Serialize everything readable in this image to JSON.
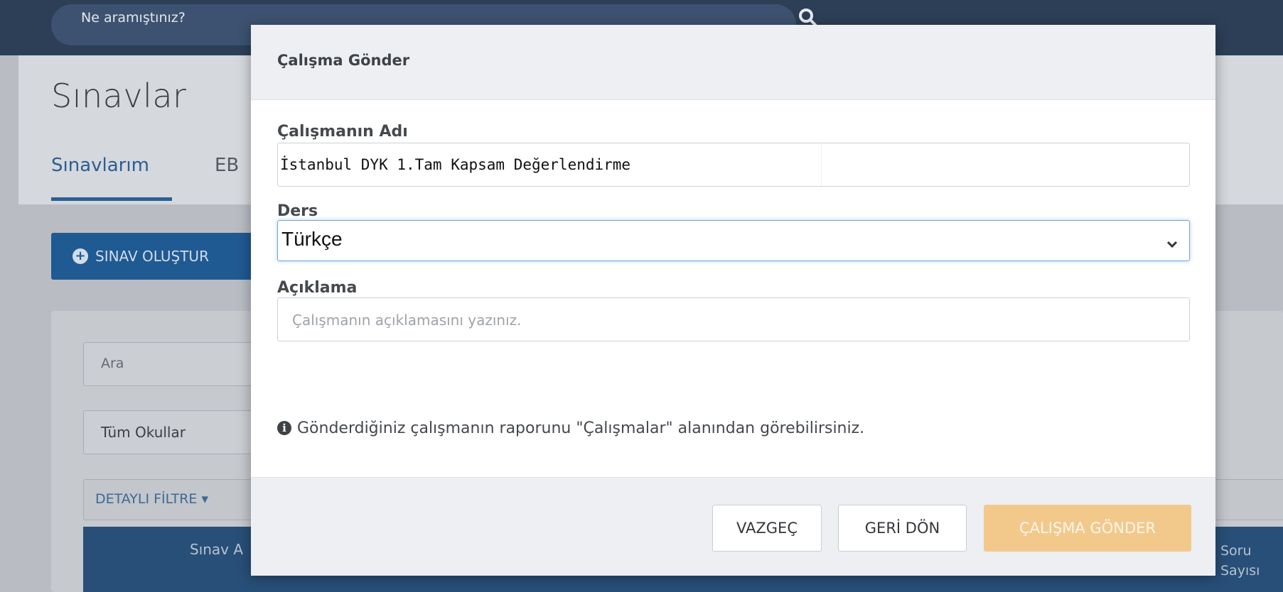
{
  "background": {
    "search_placeholder": "Ne aramıştınız?",
    "page_title": "Sınavlar",
    "tabs": [
      {
        "label": "Sınavlarım",
        "active": true
      },
      {
        "label": "EB",
        "active": false
      }
    ],
    "create_button_label": "SINAV OLUŞTUR",
    "search_input_placeholder": "Ara",
    "school_select_value": "Tüm Okullar",
    "detail_filter_label": "DETAYLI FİLTRE ▾",
    "table_headers": [
      "Sınav A",
      "Soru Sayısı"
    ]
  },
  "modal": {
    "title": "Çalışma Gönder",
    "name_label": "Çalışmanın Adı",
    "name_value": "İstanbul DYK 1.Tam Kapsam Değerlendirme",
    "subject_label": "Ders",
    "subject_value": "Türkçe",
    "description_label": "Açıklama",
    "description_placeholder": "Çalışmanın açıklamasını yazınız.",
    "info_text": "Gönderdiğiniz çalışmanın raporunu \"Çalışmalar\" alanından görebilirsiniz.",
    "buttons": {
      "cancel": "VAZGEÇ",
      "back": "GERİ DÖN",
      "submit": "ÇALIŞMA GÖNDER"
    }
  },
  "colors": {
    "topbar": "#2c3f57",
    "primary_blue": "#1f5a92",
    "submit_button_disabled": "#f3c98b",
    "focus_border": "#6ea5da"
  },
  "icons": {
    "search": "search-icon",
    "plus": "plus-circle-icon",
    "chevron": "chevron-down-icon",
    "info": "info-circle-icon"
  }
}
